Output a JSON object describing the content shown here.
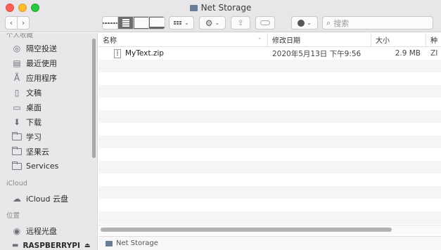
{
  "window": {
    "title": "Net Storage"
  },
  "toolbar": {
    "back_icon": "chevron-left-icon",
    "forward_icon": "chevron-right-icon",
    "search_placeholder": "搜索"
  },
  "sidebar": {
    "sections": [
      {
        "header": "个人收藏",
        "items": [
          {
            "label": "隔空投送",
            "icon": "airdrop-icon"
          },
          {
            "label": "最近使用",
            "icon": "recents-icon"
          },
          {
            "label": "应用程序",
            "icon": "applications-icon"
          },
          {
            "label": "文稿",
            "icon": "documents-icon"
          },
          {
            "label": "桌面",
            "icon": "desktop-icon"
          },
          {
            "label": "下载",
            "icon": "downloads-icon"
          },
          {
            "label": "学习",
            "icon": "folder-icon"
          },
          {
            "label": "坚果云",
            "icon": "folder-icon"
          },
          {
            "label": "Services",
            "icon": "folder-icon"
          }
        ]
      },
      {
        "header": "iCloud",
        "items": [
          {
            "label": "iCloud 云盘",
            "icon": "cloud-icon"
          }
        ]
      },
      {
        "header": "位置",
        "items": [
          {
            "label": "远程光盘",
            "icon": "disc-icon"
          },
          {
            "label": "RASPBERRYPI",
            "icon": "network-drive-icon"
          }
        ]
      }
    ]
  },
  "file_list": {
    "columns": {
      "name": "名称",
      "date": "修改日期",
      "size": "大小",
      "kind": "种"
    },
    "rows": [
      {
        "name": "MyText.zip",
        "date": "2020年5月13日 下午9:56",
        "size": "2.9 MB",
        "kind": "ZI"
      }
    ]
  },
  "pathbar": {
    "label": "Net Storage"
  }
}
